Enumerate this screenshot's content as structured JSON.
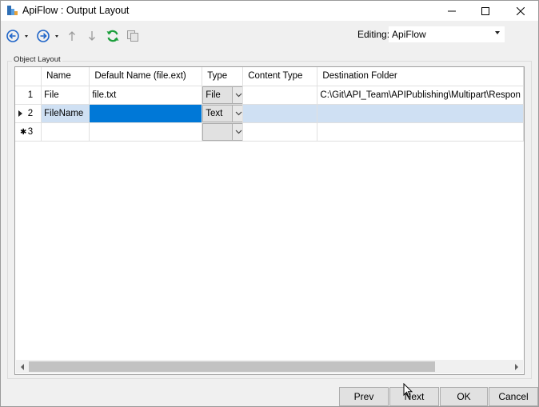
{
  "window": {
    "title": "ApiFlow : Output Layout",
    "icons": [
      "app-icon",
      "minimize-icon",
      "maximize-icon",
      "close-icon"
    ]
  },
  "toolbar": {
    "editing_label": "Editing:",
    "editing_value": "ApiFlow",
    "icons": [
      "back-icon",
      "forward-icon",
      "up-icon",
      "down-icon",
      "refresh-icon",
      "copy-icon"
    ]
  },
  "group": {
    "label": "Object Layout"
  },
  "grid": {
    "columns": [
      "",
      "Name",
      "Default Name (file.ext)",
      "Type",
      "Content Type",
      "Destination Folder"
    ],
    "rows": [
      {
        "num": "1",
        "name": "File",
        "default_name": "file.txt",
        "type": "File",
        "content_type": "",
        "destination": "C:\\Git\\API_Team\\APIPublishing\\Multipart\\Respon"
      },
      {
        "num": "2",
        "name": "FileName",
        "default_name": "",
        "type": "Text",
        "content_type": "",
        "destination": ""
      },
      {
        "num": "3",
        "name": "",
        "default_name": "",
        "type": "",
        "content_type": "",
        "destination": ""
      }
    ]
  },
  "buttons": {
    "prev": "Prev",
    "next": "Next",
    "ok": "OK",
    "cancel": "Cancel"
  },
  "colors": {
    "selection": "#0078d7",
    "selected_row": "#cfe0f3",
    "refresh_green": "#1a9e3a",
    "nav_blue": "#1e64c8"
  }
}
